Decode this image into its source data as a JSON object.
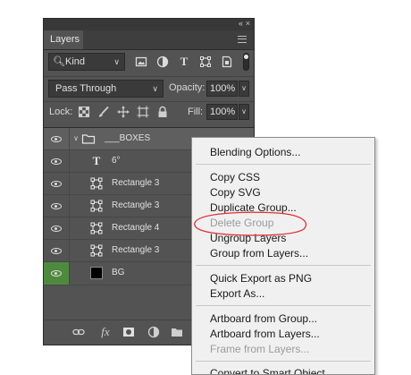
{
  "panel": {
    "tab_label": "Layers",
    "collapse_glyph": "«",
    "close_glyph": "×",
    "filter": {
      "kind_label": "Kind",
      "filter_icons": [
        "image-filter-icon",
        "adjustment-filter-icon",
        "type-filter-icon",
        "shape-filter-icon",
        "smart-object-filter-icon"
      ]
    },
    "blend_mode": "Pass Through",
    "opacity_label": "Opacity:",
    "opacity_value": "100%",
    "lock_label": "Lock:",
    "fill_label": "Fill:",
    "fill_value": "100%",
    "layers": [
      {
        "name": "___BOXES",
        "type": "group",
        "visible": true
      },
      {
        "name": "6°",
        "type": "text",
        "visible": true
      },
      {
        "name": "Rectangle 3",
        "type": "shape",
        "visible": true
      },
      {
        "name": "Rectangle 3",
        "type": "shape",
        "visible": true
      },
      {
        "name": "Rectangle 4",
        "type": "shape",
        "visible": true
      },
      {
        "name": "Rectangle 3",
        "type": "shape",
        "visible": true
      },
      {
        "name": "BG",
        "type": "fill",
        "visible": true
      }
    ],
    "bottom_icons": [
      "link-layers-icon",
      "fx-icon",
      "mask-icon",
      "adjustment-layer-icon",
      "new-group-icon"
    ],
    "fx_label": "fx"
  },
  "context_menu": {
    "items": [
      {
        "label": "Blending Options...",
        "enabled": true
      },
      {
        "label": "Copy CSS",
        "enabled": true
      },
      {
        "label": "Copy SVG",
        "enabled": true
      },
      {
        "label": "Duplicate Group...",
        "enabled": true
      },
      {
        "label": "Delete Group",
        "enabled": false
      },
      {
        "label": "Ungroup Layers",
        "enabled": true
      },
      {
        "label": "Group from Layers...",
        "enabled": true
      },
      {
        "label": "Quick Export as PNG",
        "enabled": true
      },
      {
        "label": "Export As...",
        "enabled": true
      },
      {
        "label": "Artboard from Group...",
        "enabled": true
      },
      {
        "label": "Artboard from Layers...",
        "enabled": true
      },
      {
        "label": "Frame from Layers...",
        "enabled": false
      },
      {
        "label": "Convert to Smart Object",
        "enabled": true
      }
    ]
  },
  "colors": {
    "panel_bg": "#535353",
    "visibility_highlight": "#4e8a3e",
    "annotation_red": "#e0303a",
    "menu_bg": "#f0f0f0"
  }
}
